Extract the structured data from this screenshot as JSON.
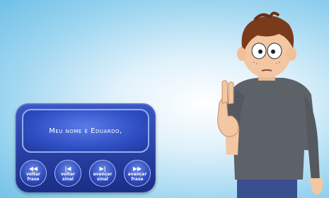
{
  "subtitle": {
    "text": "Meu nome é Eduardo,"
  },
  "controls": [
    {
      "icon": "◀◀",
      "line1": "voltar",
      "line2": "frase"
    },
    {
      "icon": "|◀",
      "line1": "voltar",
      "line2": "sinal"
    },
    {
      "icon": "▶|",
      "line1": "avançar",
      "line2": "sinal"
    },
    {
      "icon": "▶▶",
      "line1": "avançar",
      "line2": "frase"
    }
  ]
}
